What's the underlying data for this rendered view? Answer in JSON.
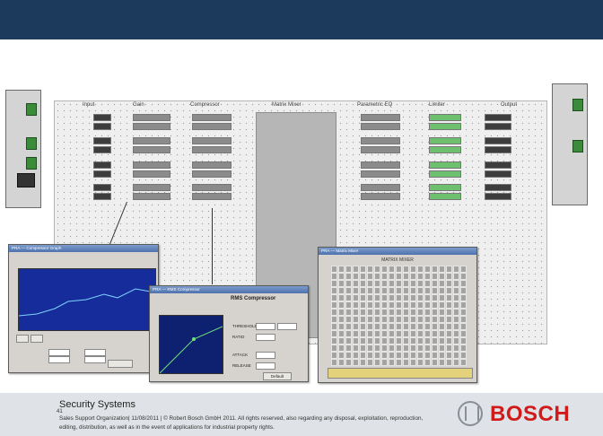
{
  "header": {
    "bar_color": "#1c3a5c"
  },
  "footer": {
    "title": "Security Systems",
    "page_number": "41",
    "note": "Sales Support Organization| 11/08/2011 | © Robert Bosch GmbH 2011. All rights reserved, also regarding any disposal, exploitation, reproduction, editing, distribution, as well as in the event of applications for industrial property rights.",
    "logo_text": "BOSCH"
  },
  "diagram": {
    "headers": [
      "Input",
      "Gain",
      "Compressor",
      "Matrix Mixer",
      "Parametric EQ",
      "Limiter",
      "Output"
    ],
    "matrix_label": "Matrix Mixer",
    "matrix_color": "#b6b6b6"
  },
  "windows": {
    "compressor_small": {
      "title": "PRA — Compressor Graph"
    },
    "rms_compressor": {
      "title": "PRA — RMS Compressor",
      "heading": "RMS Compressor",
      "labels": [
        "THRESHOLD",
        "RATIO",
        "ATTACK",
        "RELEASE"
      ],
      "button": "Default"
    },
    "matrix": {
      "title": "PRA — Matrix Mixer",
      "heading": "MATRIX MIXER"
    }
  }
}
